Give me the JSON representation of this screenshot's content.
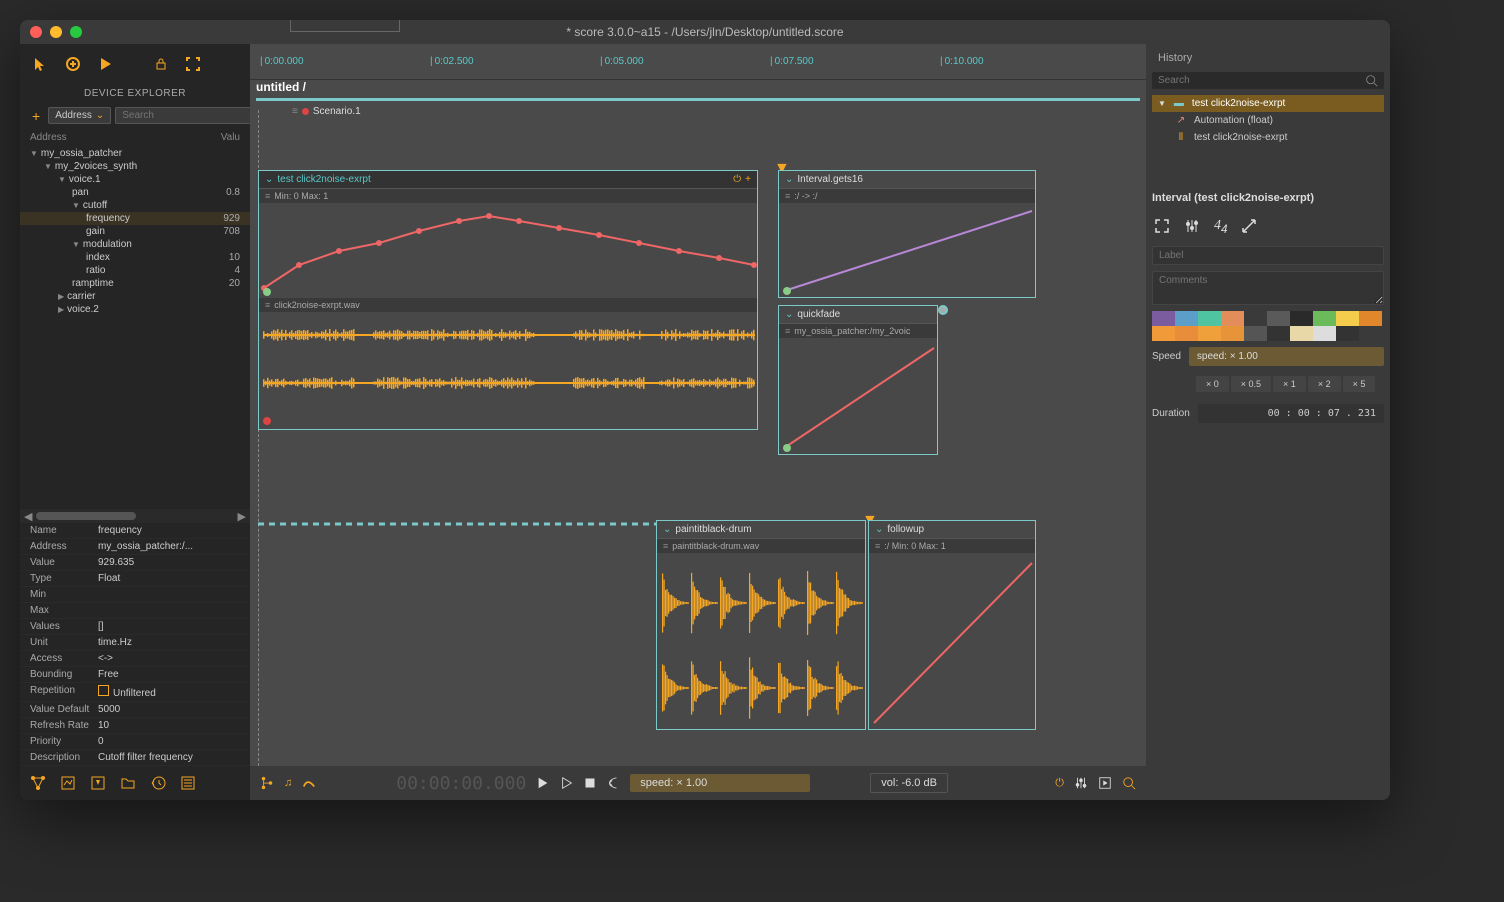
{
  "titlebar": {
    "title": "* score 3.0.0~a15 - /Users/jln/Desktop/untitled.score"
  },
  "sidebar": {
    "title": "DEVICE EXPLORER",
    "addressDropdown": "Address",
    "searchPlaceholder": "Search",
    "treeHeader": {
      "address": "Address",
      "value": "Valu"
    },
    "tree": [
      {
        "indent": 0,
        "label": "my_ossia_patcher",
        "value": "",
        "expanded": true
      },
      {
        "indent": 1,
        "label": "my_2voices_synth",
        "value": "",
        "expanded": true
      },
      {
        "indent": 2,
        "label": "voice.1",
        "value": "",
        "expanded": true
      },
      {
        "indent": 3,
        "label": "pan",
        "value": "0.8"
      },
      {
        "indent": 3,
        "label": "cutoff",
        "value": "",
        "expanded": true
      },
      {
        "indent": 4,
        "label": "frequency",
        "value": "929",
        "selected": true
      },
      {
        "indent": 4,
        "label": "gain",
        "value": "708"
      },
      {
        "indent": 3,
        "label": "modulation",
        "value": "",
        "expanded": true
      },
      {
        "indent": 4,
        "label": "index",
        "value": "10"
      },
      {
        "indent": 4,
        "label": "ratio",
        "value": "4"
      },
      {
        "indent": 3,
        "label": "ramptime",
        "value": "20"
      },
      {
        "indent": 2,
        "label": "carrier",
        "value": "",
        "expanded": false
      },
      {
        "indent": 2,
        "label": "voice.2",
        "value": "",
        "expanded": false
      }
    ],
    "props": {
      "Name": "frequency",
      "Address": "my_ossia_patcher:/...",
      "Value": "929.635",
      "Type": "Float",
      "Min": "",
      "Max": "",
      "Values": "[]",
      "Unit": "time.Hz",
      "Access": "<->",
      "Bounding": "Free",
      "Repetition": "Unfiltered",
      "Value Default": "5000",
      "Refresh Rate": "10",
      "Priority": "0",
      "Description": "Cutoff filter frequency"
    }
  },
  "timeline": {
    "path": "untitled /",
    "scenario": "Scenario.1",
    "ruler": [
      "0:00.000",
      "0:02.500",
      "0:05.000",
      "0:07.500",
      "0:10.000"
    ],
    "intervals": {
      "test": {
        "title": "test click2noise-exrpt",
        "minmax": "Min: 0  Max: 1",
        "wavlabel": "click2noise-exrpt.wav"
      },
      "intervalGets": {
        "title": "Interval.gets16",
        "sublabel": ":/ -> :/"
      },
      "quickfade": {
        "title": "quickfade",
        "sublabel": "my_ossia_patcher:/my_2voic"
      },
      "paintitblack": {
        "title": "paintitblack-drum",
        "wavlabel": "paintitblack-drum.wav"
      },
      "followup": {
        "title": "followup",
        "sublabel": ":/ Min: 0  Max: 1"
      }
    }
  },
  "transport": {
    "time": "00:00:00.000",
    "speed": "speed: × 1.00",
    "vol": "vol: -6.0 dB"
  },
  "rightPanel": {
    "historyTitle": "History",
    "searchPlaceholder": "Search",
    "history": [
      {
        "label": "test click2noise-exrpt",
        "icon": "interval",
        "selected": true
      },
      {
        "label": "Automation (float)",
        "icon": "automation"
      },
      {
        "label": "test click2noise-exrpt",
        "icon": "sound"
      }
    ],
    "inspectorTitle": "Interval (test click2noise-exrpt)",
    "labelPlaceholder": "Label",
    "commentsPlaceholder": "Comments",
    "colors": [
      "#7b5c9e",
      "#5a9ec9",
      "#4fc4a0",
      "#e38e5a",
      "#3a3a3a",
      "#5a5a5a",
      "#2a2a2a",
      "#6bbb5a",
      "#f5cd4c",
      "#e0862b",
      "#f09a3a",
      "#e88e3a",
      "#f0a03a",
      "#e6933a",
      "#555",
      "#333",
      "#e8d8a8",
      "#ddd",
      "#333"
    ],
    "speedLabel": "Speed",
    "speedValue": "speed: × 1.00",
    "speedPresets": [
      "× 0",
      "× 0.5",
      "× 1",
      "× 2",
      "× 5"
    ],
    "durationLabel": "Duration",
    "durationValue": "00 : 00 : 07 .   231"
  }
}
